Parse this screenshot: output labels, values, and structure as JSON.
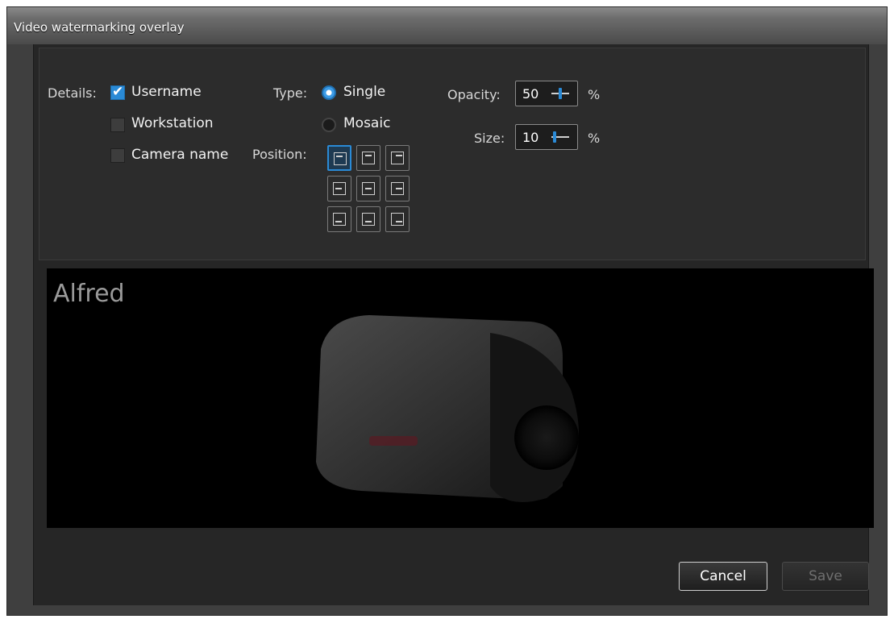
{
  "window": {
    "title": "Video watermarking overlay"
  },
  "details": {
    "label": "Details:",
    "options": [
      {
        "label": "Username",
        "checked": true
      },
      {
        "label": "Workstation",
        "checked": false
      },
      {
        "label": "Camera name",
        "checked": false
      }
    ]
  },
  "type": {
    "label": "Type:",
    "options": [
      {
        "label": "Single",
        "selected": true
      },
      {
        "label": "Mosaic",
        "selected": false
      }
    ]
  },
  "position": {
    "label": "Position:",
    "selected": "top-left"
  },
  "opacity": {
    "label": "Opacity:",
    "value": "50",
    "unit": "%"
  },
  "size": {
    "label": "Size:",
    "value": "10",
    "unit": "%"
  },
  "preview": {
    "watermark_text": "Alfred"
  },
  "buttons": {
    "cancel": "Cancel",
    "save": "Save"
  },
  "colors": {
    "accent": "#2a8ad6",
    "background": "#262626"
  }
}
